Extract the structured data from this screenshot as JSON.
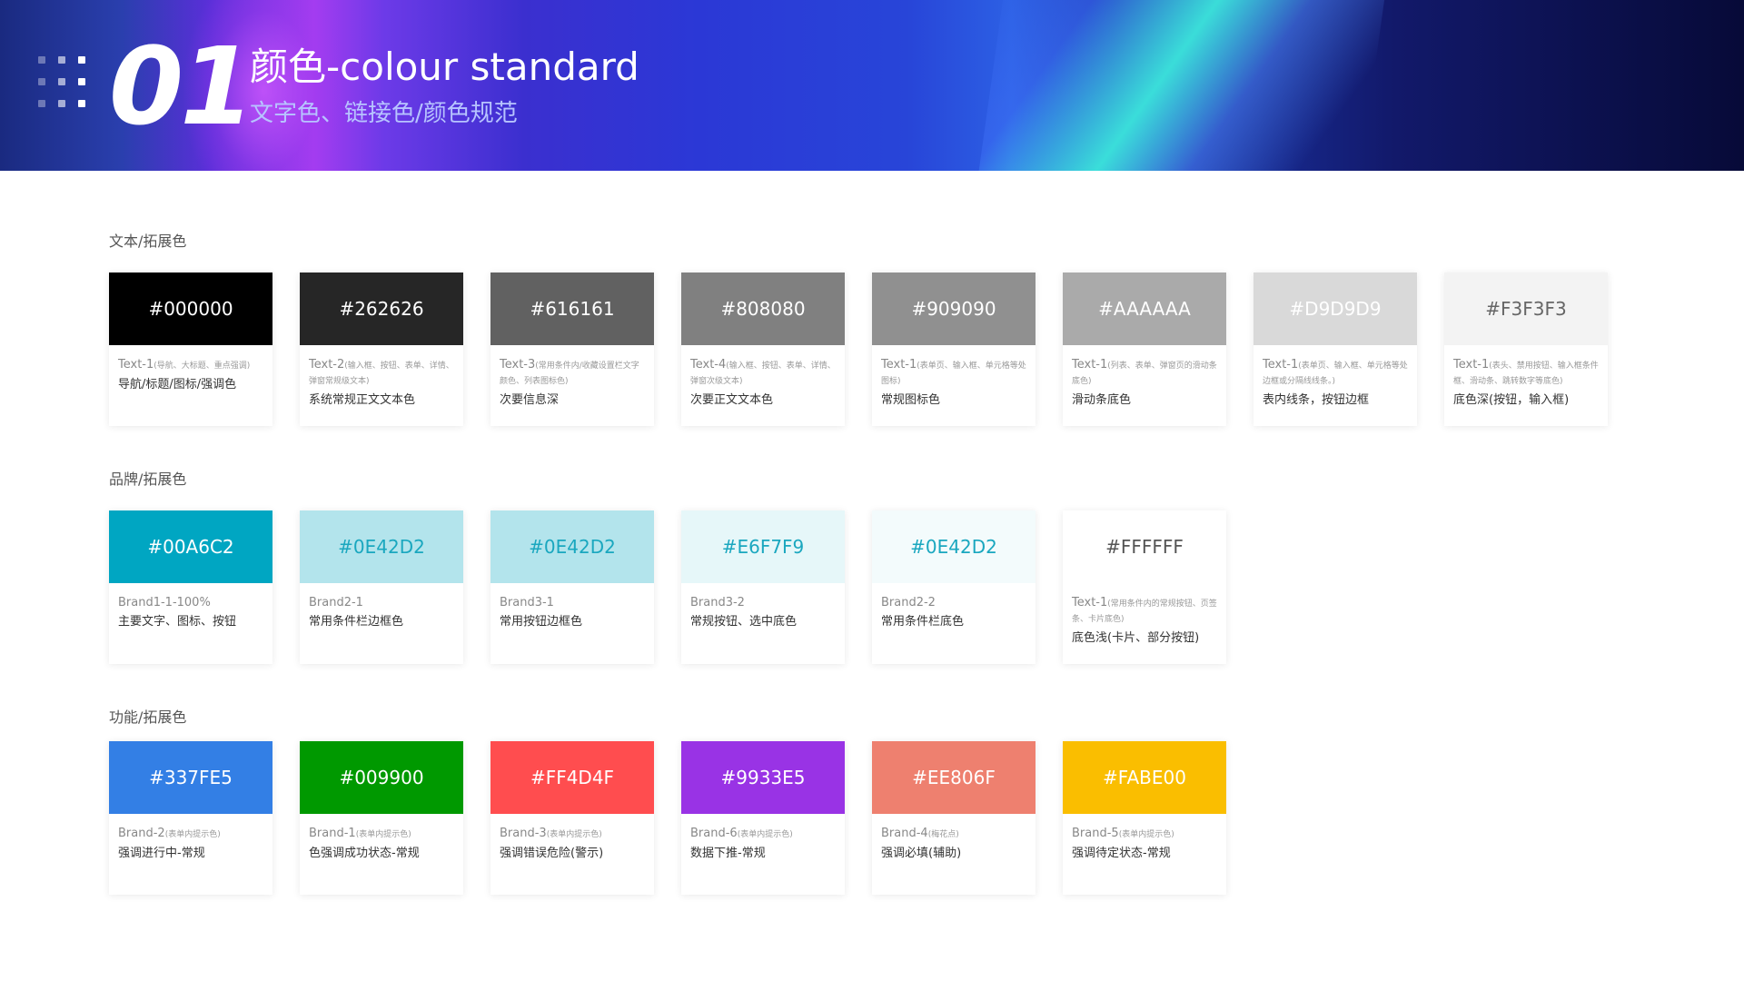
{
  "header": {
    "number": "01",
    "title": "颜色-colour standard",
    "subtitle": "文字色、链接色/颜色规范"
  },
  "sections": [
    {
      "label": "文本/拓展色",
      "cards": [
        {
          "hex": "#000000",
          "bg": "#000000",
          "text_color": "#ffffff",
          "code": "Text-1",
          "note": "(导航、大标题、重点强调)",
          "desc": "导航/标题/图标/强调色"
        },
        {
          "hex": "#262626",
          "bg": "#262626",
          "text_color": "#ffffff",
          "code": "Text-2",
          "note": "(输入框、按钮、表单、详情、弹窗常规级文本)",
          "desc": "系统常规正文文本色"
        },
        {
          "hex": "#616161",
          "bg": "#616161",
          "text_color": "#ffffff",
          "code": "Text-3",
          "note": "(常用条件内/收藏设置栏文字颜色、列表图标色)",
          "desc": "次要信息深"
        },
        {
          "hex": "#808080",
          "bg": "#808080",
          "text_color": "#ffffff",
          "code": "Text-4",
          "note": "(输入框、按钮、表单、详情、弹窗次级文本)",
          "desc": "次要正文文本色"
        },
        {
          "hex": "#909090",
          "bg": "#909090",
          "text_color": "#ffffff",
          "code": "Text-1",
          "note": "(表单页、输入框、单元格等处图标)",
          "desc": "常规图标色"
        },
        {
          "hex": "#AAAAAA",
          "bg": "#AAAAAA",
          "text_color": "#ffffff",
          "code": "Text-1",
          "note": "(列表、表单、弹窗页的滑动条底色)",
          "desc": "滑动条底色"
        },
        {
          "hex": "#D9D9D9",
          "bg": "#D9D9D9",
          "text_color": "#ffffff",
          "code": "Text-1",
          "note": "(表单页、输入框、单元格等处边框或分隔线线条。)",
          "desc": "表内线条，按钮边框"
        },
        {
          "hex": "#F3F3F3",
          "bg": "#F3F3F3",
          "text_color": "#666666",
          "code": "Text-1",
          "note": "(表头、禁用按钮、输入框条件框、滑动条、跳转数字等底色)",
          "desc": "底色深(按钮，输入框)"
        }
      ]
    },
    {
      "label": "品牌/拓展色",
      "cards": [
        {
          "hex": "#00A6C2",
          "bg": "#00A6C2",
          "text_color": "#ffffff",
          "code": "Brand1-1-100%",
          "note": "",
          "desc": "主要文字、图标、按钮"
        },
        {
          "hex": "#0E42D2",
          "bg": "#B3E4EC",
          "text_color": "#1aa7bf",
          "code": "Brand2-1",
          "note": "",
          "desc": "常用条件栏边框色"
        },
        {
          "hex": "#0E42D2",
          "bg": "#B3E4EC",
          "text_color": "#1aa7bf",
          "code": "Brand3-1",
          "note": "",
          "desc": "常用按钮边框色"
        },
        {
          "hex": "#E6F7F9",
          "bg": "#E6F7F9",
          "text_color": "#1aa7bf",
          "code": "Brand3-2",
          "note": "",
          "desc": "常规按钮、选中底色"
        },
        {
          "hex": "#0E42D2",
          "bg": "#F3FBFC",
          "text_color": "#1aa7bf",
          "code": "Brand2-2",
          "note": "",
          "desc": "常用条件栏底色"
        },
        {
          "hex": "#FFFFFF",
          "bg": "#FFFFFF",
          "text_color": "#555555",
          "code": "Text-1",
          "note": "(常用条件内的常规按钮、页签条、卡片底色)",
          "desc": "底色浅(卡片、部分按钮)"
        }
      ]
    },
    {
      "label": "功能/拓展色",
      "cards": [
        {
          "hex": "#337FE5",
          "bg": "#337FE5",
          "text_color": "#ffffff",
          "code": "Brand-2",
          "note": "(表单内提示色)",
          "desc": "强调进行中-常规"
        },
        {
          "hex": "#009900",
          "bg": "#009900",
          "text_color": "#ffffff",
          "code": "Brand-1",
          "note": "(表单内提示色)",
          "desc": "色强调成功状态-常规"
        },
        {
          "hex": "#FF4D4F",
          "bg": "#FF4D4F",
          "text_color": "#ffffff",
          "code": "Brand-3",
          "note": "(表单内提示色)",
          "desc": "强调错误危险(警示)"
        },
        {
          "hex": "#9933E5",
          "bg": "#9933E5",
          "text_color": "#ffffff",
          "code": "Brand-6",
          "note": "(表单内提示色)",
          "desc": "数据下推-常规"
        },
        {
          "hex": "#EE806F",
          "bg": "#EE806F",
          "text_color": "#ffffff",
          "code": "Brand-4",
          "note": "(梅花点)",
          "desc": "强调必填(辅助)"
        },
        {
          "hex": "#FABE00",
          "bg": "#FABE00",
          "text_color": "#ffffff",
          "code": "Brand-5",
          "note": "(表单内提示色)",
          "desc": "强调待定状态-常规"
        }
      ]
    }
  ]
}
